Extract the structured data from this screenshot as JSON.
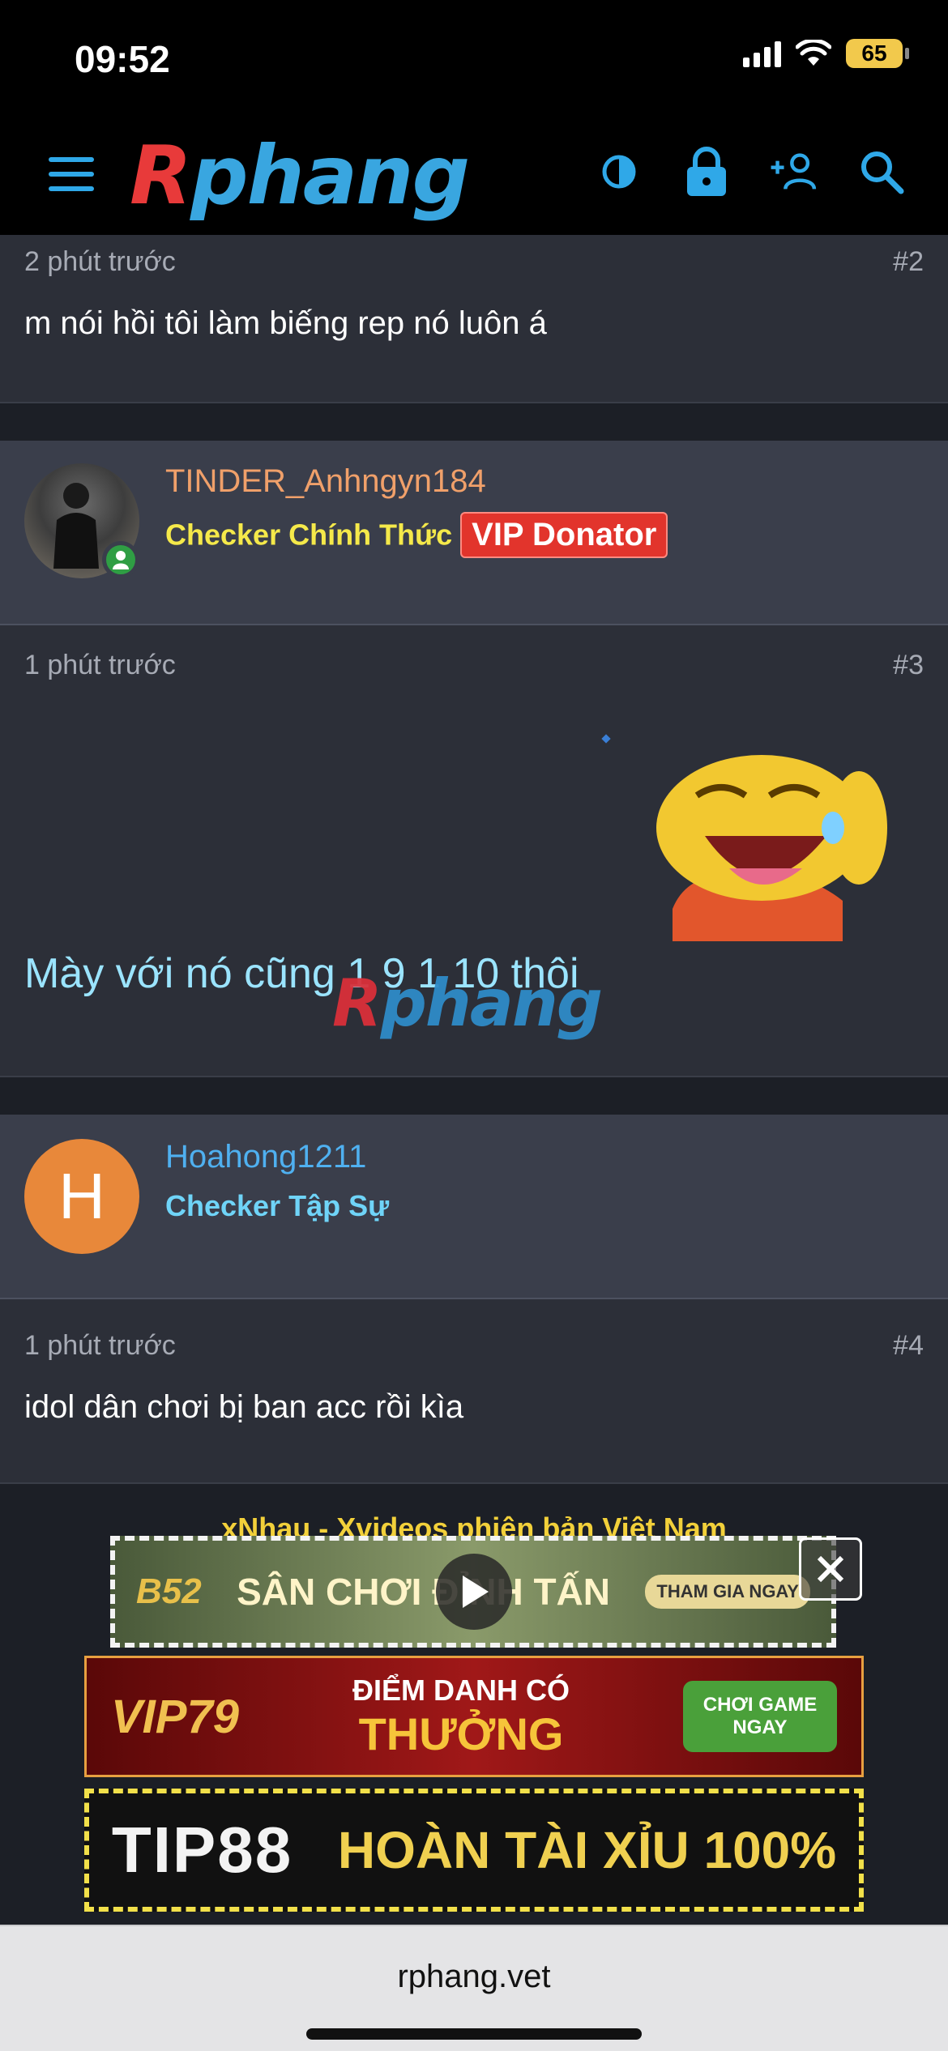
{
  "status_bar": {
    "time": "09:52",
    "battery": "65"
  },
  "nav": {
    "logo_first": "R",
    "logo_rest": "phang"
  },
  "posts": [
    {
      "time": "2 phút trước",
      "number": "#2",
      "text": "m nói hồi tôi làm biếng rep nó luôn á"
    },
    {
      "user": "TINDER_Anhngyn184",
      "title": "Checker Chính Thức",
      "badge": "VIP Donator",
      "time": "1 phút trước",
      "number": "#3",
      "text": "Mày với nó cũng 1 9 1 10 thôi",
      "watermark_first": "R",
      "watermark_rest": "phang"
    },
    {
      "user": "Hoahong1211",
      "avatar_letter": "H",
      "title": "Checker Tập Sự",
      "time": "1 phút trước",
      "number": "#4",
      "text": "idol dân chơi bị ban acc rồi kìa"
    }
  ],
  "ads": {
    "caption": "xNhau - Xvideos phiên bản Việt Nam",
    "banner1": {
      "brand": "B52",
      "text": "SÂN CHƠI ĐỈNH TẤN",
      "cta": "THAM GIA NGAY"
    },
    "banner2": {
      "brand": "VIP79",
      "line1": "ĐIỂM DANH CÓ",
      "line2": "THƯỞNG",
      "cta": "CHƠI GAME NGAY"
    },
    "banner3": {
      "brand": "TIP88",
      "text": "HOÀN TÀI XỈU 100%"
    }
  },
  "browser": {
    "url": "rphang.vet"
  }
}
